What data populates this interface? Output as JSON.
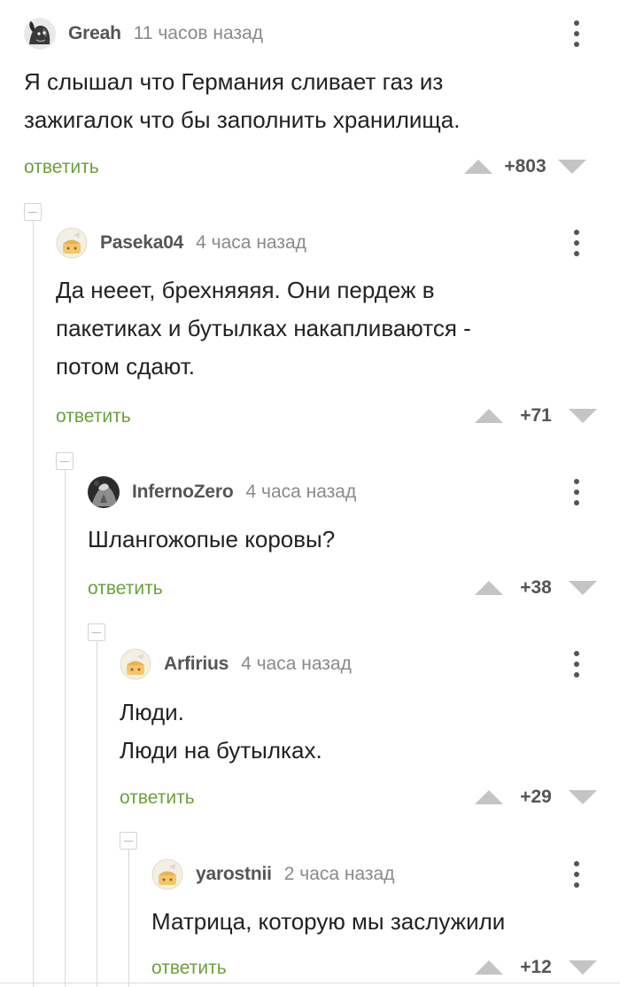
{
  "comments": [
    {
      "username": "Greah",
      "time": "11 часов назад",
      "text": "Я слышал что Германия сливает газ из\nзажигалок что бы заполнить хранилища.",
      "reply_label": "ответить",
      "rating": "+803",
      "avatar_icon": "dog-photo-avatar"
    },
    {
      "username": "Paseka04",
      "time": "4 часа назад",
      "text": "Да нееет, брехняяяя. Они пердеж в\nпакетиках и бутылках накапливаются -\nпотом сдают.",
      "reply_label": "ответить",
      "rating": "+71",
      "avatar_icon": "default-avatar"
    },
    {
      "username": "InfernoZero",
      "time": "4 часа назад",
      "text": "Шлангожопые коровы?",
      "reply_label": "ответить",
      "rating": "+38",
      "avatar_icon": "photo-avatar"
    },
    {
      "username": "Arfirius",
      "time": "4 часа назад",
      "text": "Люди.\nЛюди на бутылках.",
      "reply_label": "ответить",
      "rating": "+29",
      "avatar_icon": "default-avatar"
    },
    {
      "username": "yarostnii",
      "time": "2 часа назад",
      "text": "Матрица, которую мы заслужили",
      "reply_label": "ответить",
      "rating": "+12",
      "avatar_icon": "default-avatar"
    }
  ],
  "colors": {
    "reply": "#6aa13a",
    "username": "#555555",
    "meta": "#8a8a8a",
    "vote_arrow": "#c4c4c4"
  }
}
